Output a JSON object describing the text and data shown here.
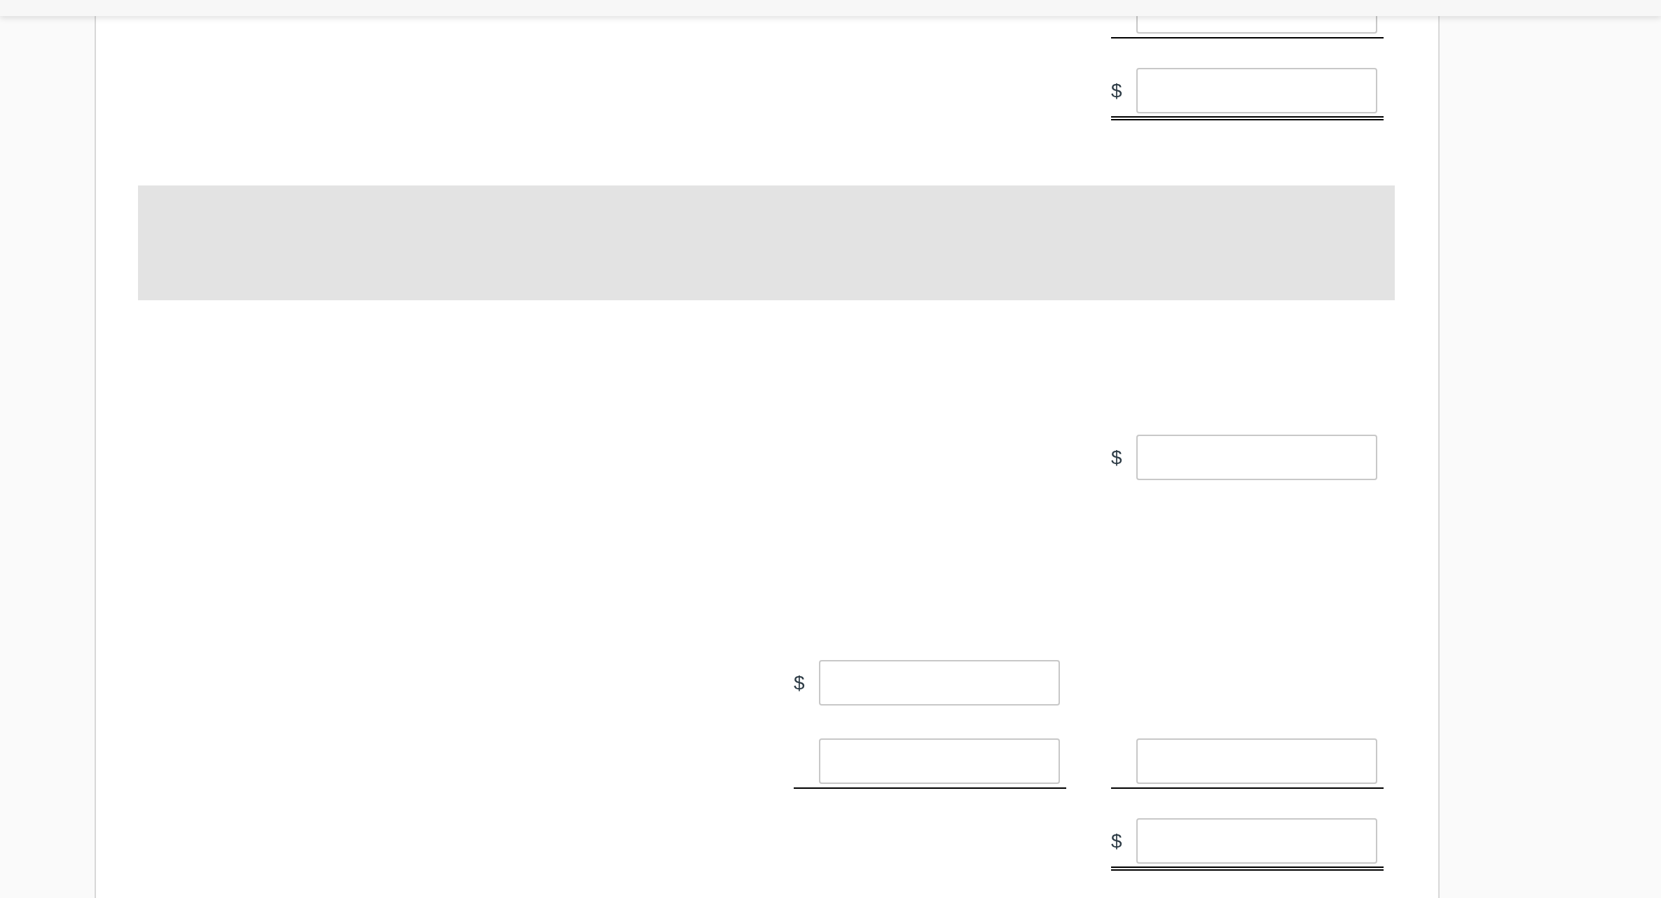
{
  "worksheet": {
    "rows": [
      {
        "kind": "fields",
        "right": {
          "kind": "cut_off",
          "underlined": true,
          "double_underlined": false
        }
      },
      {
        "kind": "fields",
        "right": {
          "kind": "amount",
          "prefix": "$",
          "underlined": false,
          "double_underlined": true
        }
      },
      {
        "kind": "blank_block"
      },
      {
        "kind": "fields",
        "right": {
          "kind": "amount",
          "prefix": "$",
          "underlined": false,
          "double_underlined": false
        }
      },
      {
        "kind": "fields",
        "left": {
          "kind": "amount",
          "prefix": "$",
          "underlined": false,
          "double_underlined": false
        }
      },
      {
        "kind": "fields",
        "left": {
          "kind": "amount",
          "underlined": true,
          "double_underlined": false
        },
        "right": {
          "kind": "amount",
          "underlined": true,
          "double_underlined": false
        }
      },
      {
        "kind": "fields",
        "right": {
          "kind": "amount",
          "prefix": "$",
          "underlined": false,
          "double_underlined": true
        }
      }
    ]
  }
}
